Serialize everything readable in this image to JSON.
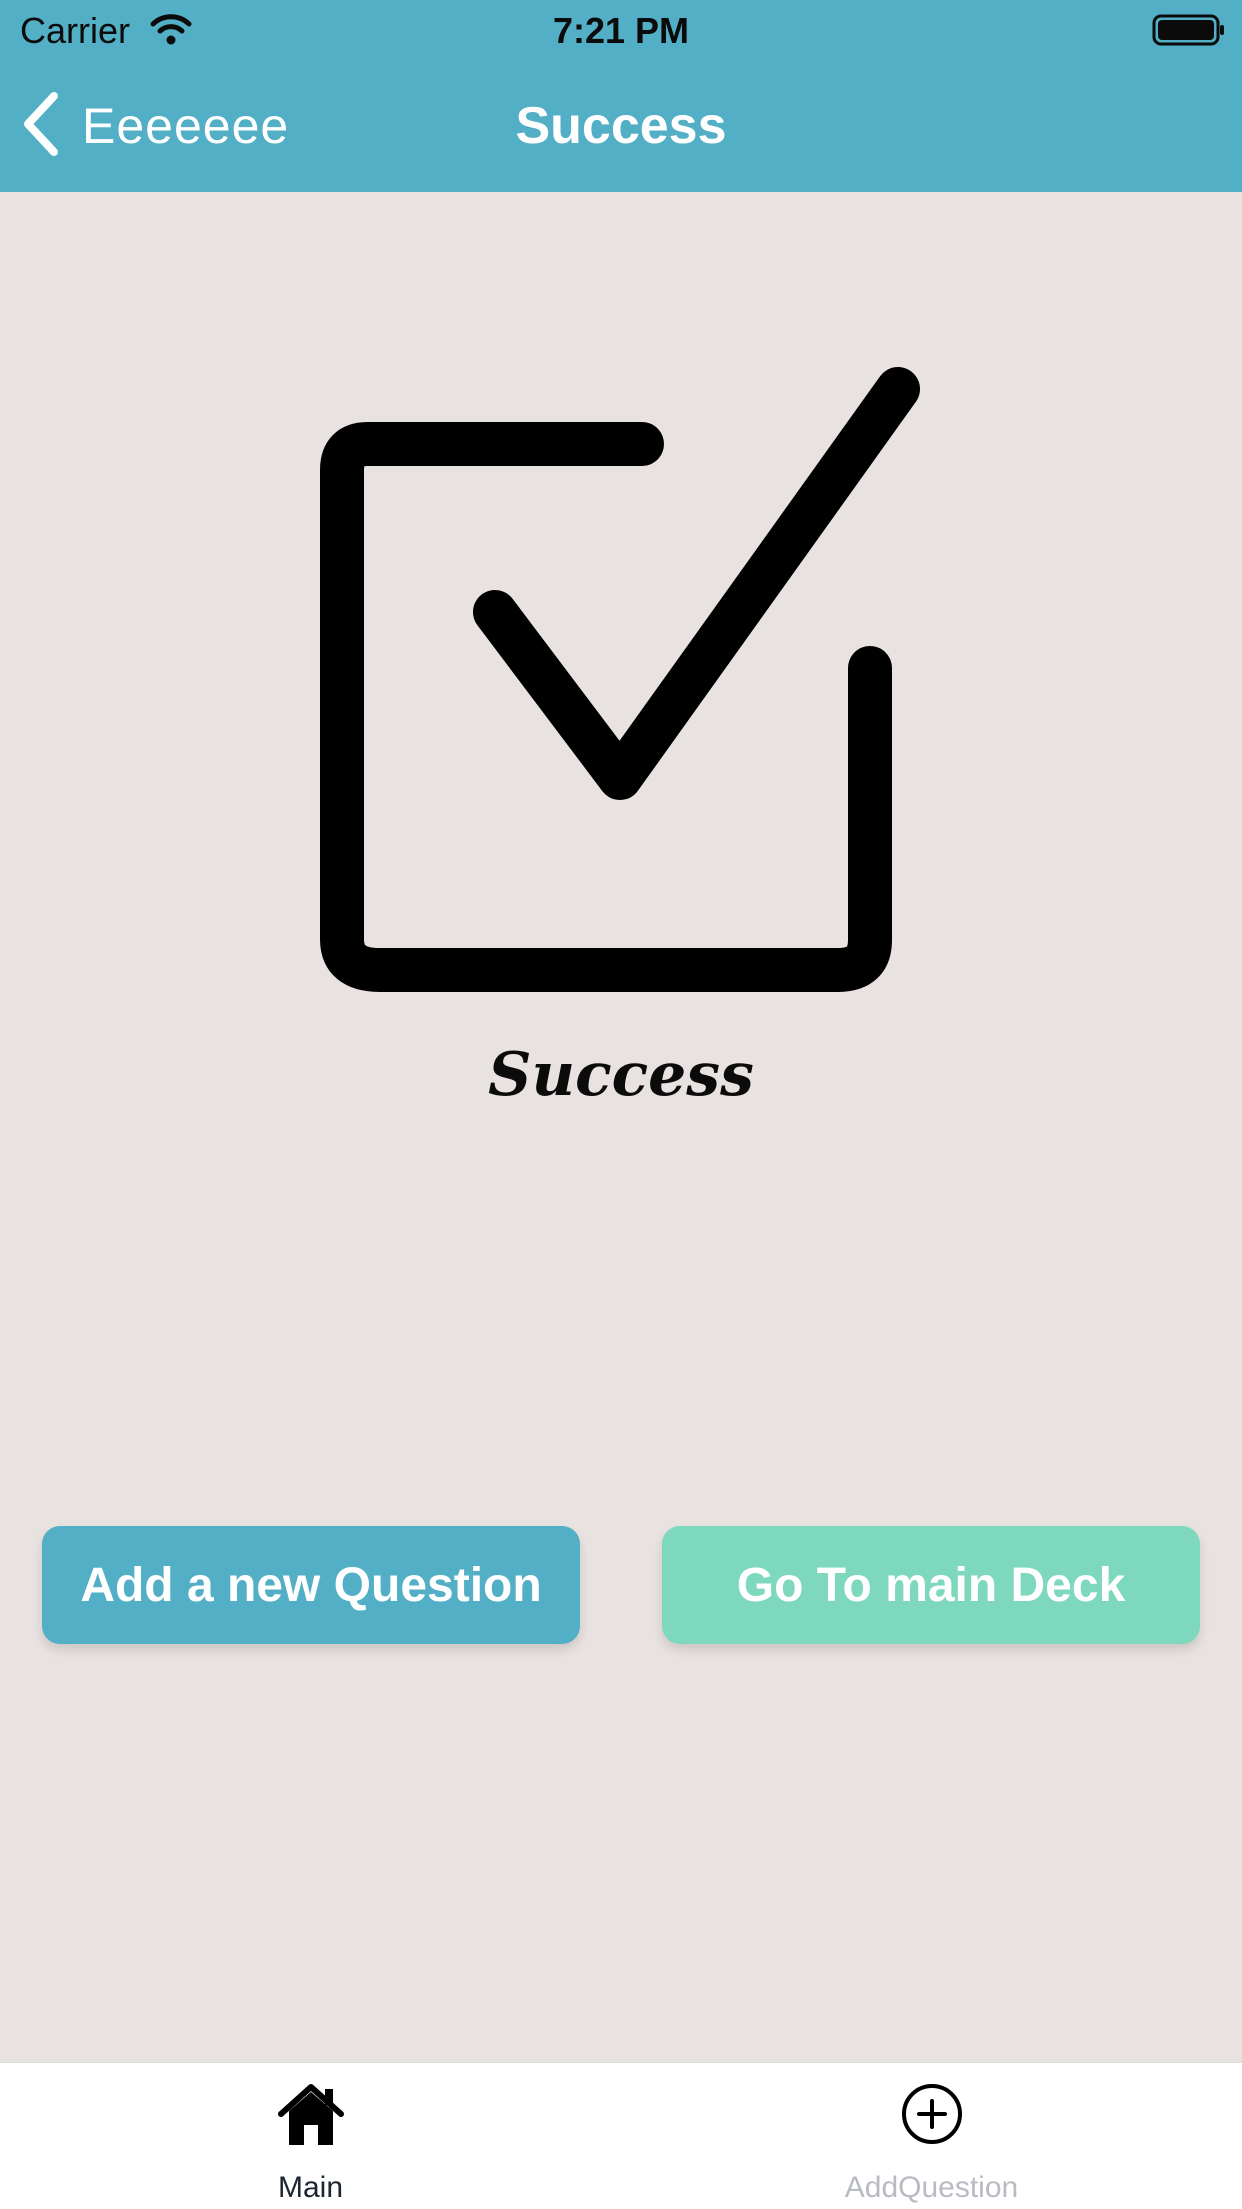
{
  "status_bar": {
    "carrier": "Carrier",
    "time": "7:21 PM",
    "wifi_icon": "wifi-icon",
    "battery_icon": "battery-icon"
  },
  "nav": {
    "back_label": "Eeeeeee",
    "title": "Success",
    "back_icon": "chevron-left-icon",
    "background": "#52afc6"
  },
  "content": {
    "icon": "checkbox-checked-icon",
    "message": "Success",
    "background": "#e8e2e0"
  },
  "buttons": {
    "add_question": {
      "label": "Add a new Question",
      "color": "#52afc6"
    },
    "go_to_deck": {
      "label": "Go To main Deck",
      "color": "#7ed8bd"
    }
  },
  "tabs": [
    {
      "label": "Main",
      "icon": "home-icon",
      "active": true
    },
    {
      "label": "AddQuestion",
      "icon": "plus-circle-icon",
      "active": false
    }
  ]
}
